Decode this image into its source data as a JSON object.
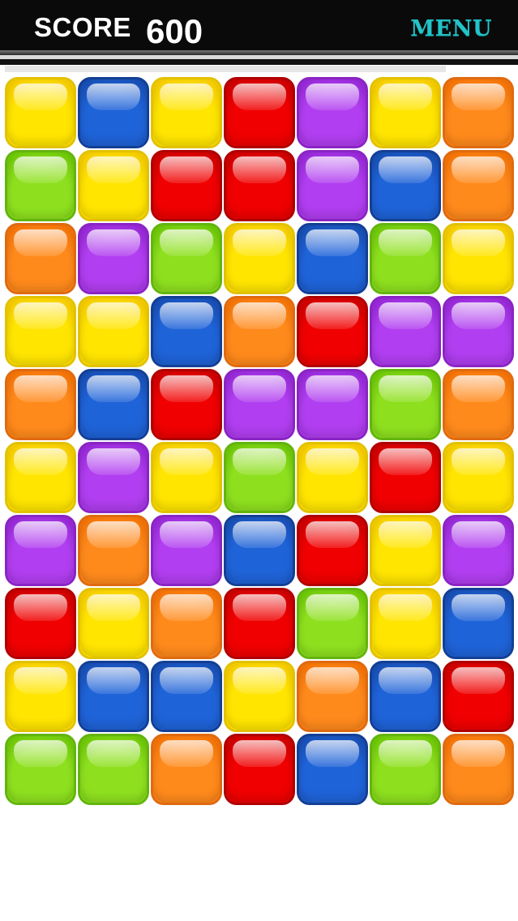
{
  "header": {
    "score_label": "SCORE",
    "score_value": "600",
    "menu_label": "MENU"
  },
  "colors": {
    "yellow": "#ffe500",
    "blue": "#1f63d8",
    "red": "#f00000",
    "purple": "#b13ef0",
    "orange": "#ff8a1c",
    "green": "#8ee01f",
    "menu_accent": "#23c3c8",
    "topbar": "#0a0a0a"
  },
  "board": {
    "columns": 7,
    "rows": [
      [
        "yellow",
        "blue",
        "yellow",
        "red",
        "purple",
        "yellow",
        "orange"
      ],
      [
        "green",
        "yellow",
        "red",
        "red",
        "purple",
        "blue",
        "orange"
      ],
      [
        "orange",
        "purple",
        "green",
        "yellow",
        "blue",
        "green",
        "yellow"
      ],
      [
        "yellow",
        "yellow",
        "blue",
        "orange",
        "red",
        "purple",
        "purple"
      ],
      [
        "orange",
        "blue",
        "red",
        "purple",
        "purple",
        "green",
        "orange"
      ],
      [
        "yellow",
        "purple",
        "yellow",
        "green",
        "yellow",
        "red",
        "yellow"
      ],
      [
        "purple",
        "orange",
        "purple",
        "blue",
        "red",
        "yellow",
        "purple"
      ],
      [
        "red",
        "yellow",
        "orange",
        "red",
        "green",
        "yellow",
        "blue"
      ],
      [
        "yellow",
        "blue",
        "blue",
        "yellow",
        "orange",
        "blue",
        "red"
      ],
      [
        "green",
        "green",
        "orange",
        "red",
        "blue",
        "green",
        "orange"
      ]
    ]
  }
}
